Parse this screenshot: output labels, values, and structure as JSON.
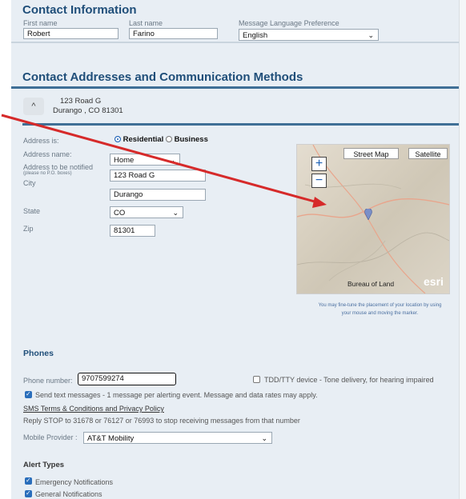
{
  "contact": {
    "title": "Contact Information",
    "first_name_label": "First name",
    "first_name_value": "Robert",
    "last_name_label": "Last name",
    "last_name_value": "Farino",
    "lang_label": "Message Language Preference",
    "lang_value": "English"
  },
  "addresses": {
    "title": "Contact Addresses and Communication Methods",
    "card_line1": "123 Road G",
    "card_line2": "Durango , CO  81301",
    "address_is_label": "Address is:",
    "residential_label": "Residential",
    "business_label": "Business",
    "address_name_label": "Address name:",
    "address_name_value": "Home",
    "notify_label": "Address to be notified",
    "notify_note": "(please no P.O. boxes)",
    "notify_value": "123 Road G",
    "city_label": "City",
    "city_value": "Durango",
    "state_label": "State",
    "state_value": "CO",
    "zip_label": "Zip",
    "zip_value": "81301"
  },
  "map": {
    "street_map_label": "Street Map",
    "satellite_label": "Satellite",
    "zoom_in": "+",
    "zoom_out": "−",
    "attribution": "Bureau of Land",
    "esri": "esri",
    "fine_tune_note": "You may fine-tune the placement of your location by using your mouse and moving the marker."
  },
  "phones": {
    "title": "Phones",
    "phone_label": "Phone number:",
    "phone_value": "9707599274",
    "tdd_label": "TDD/TTY device - Tone delivery, for hearing impaired",
    "send_text_label": "Send text messages - 1 message per alerting event. Message and data rates may apply.",
    "sms_terms_link": "SMS Terms & Conditions and Privacy Policy",
    "stop_note": "Reply STOP to 31678 or 76127 or 76993 to stop receiving messages from that number",
    "provider_label": "Mobile Provider :",
    "provider_value": "AT&T Mobility"
  },
  "alerts": {
    "title": "Alert Types",
    "emergency_label": "Emergency Notifications",
    "general_label": "General Notifications"
  },
  "icons": {
    "chevron_up": "chevron-up-icon",
    "map_marker": "map-marker-icon",
    "dropdown": "chevron-down-icon"
  },
  "colors": {
    "heading": "#1f4e79",
    "rule": "#3f6f96",
    "arrow": "#d62a2a",
    "accent": "#2a6ebb"
  }
}
